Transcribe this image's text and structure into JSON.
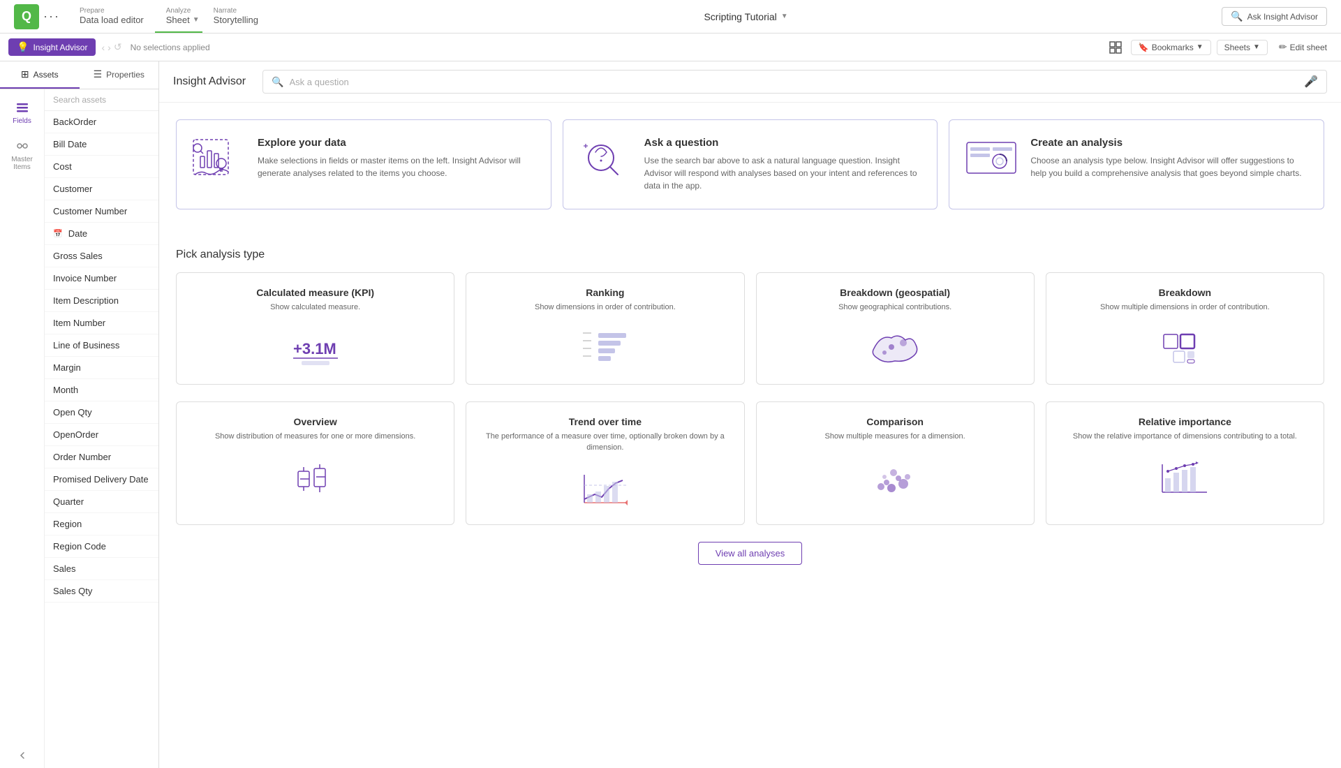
{
  "topbar": {
    "logo_text": "Q",
    "nav_items": [
      {
        "label_top": "Prepare",
        "label_main": "Data load editor",
        "active": false
      },
      {
        "label_top": "Analyze",
        "label_main": "Sheet",
        "active": true
      },
      {
        "label_top": "Narrate",
        "label_main": "Storytelling",
        "active": false
      }
    ],
    "app_title": "Scripting Tutorial",
    "search_btn_label": "Ask Insight Advisor",
    "bookmarks_label": "Bookmarks",
    "sheets_label": "Sheets",
    "edit_sheet_label": "Edit sheet"
  },
  "second_bar": {
    "insight_tab_label": "Insight Advisor",
    "no_selection_label": "No selections applied"
  },
  "sidebar": {
    "tabs": [
      {
        "label": "Assets",
        "active": true
      },
      {
        "label": "Properties",
        "active": false
      }
    ],
    "nav_items": [
      {
        "label": "Fields",
        "active": true,
        "icon": "≡"
      },
      {
        "label": "Master Items",
        "active": false,
        "icon": "⛓"
      }
    ],
    "search_placeholder": "Search assets",
    "fields": [
      {
        "label": "BackOrder",
        "has_icon": false
      },
      {
        "label": "Bill Date",
        "has_icon": false
      },
      {
        "label": "Cost",
        "has_icon": false
      },
      {
        "label": "Customer",
        "has_icon": false
      },
      {
        "label": "Customer Number",
        "has_icon": false
      },
      {
        "label": "Date",
        "has_icon": true,
        "icon": "📅"
      },
      {
        "label": "Gross Sales",
        "has_icon": false
      },
      {
        "label": "Invoice Number",
        "has_icon": false
      },
      {
        "label": "Item Description",
        "has_icon": false
      },
      {
        "label": "Item Number",
        "has_icon": false
      },
      {
        "label": "Line of Business",
        "has_icon": false
      },
      {
        "label": "Margin",
        "has_icon": false
      },
      {
        "label": "Month",
        "has_icon": false
      },
      {
        "label": "Open Qty",
        "has_icon": false
      },
      {
        "label": "OpenOrder",
        "has_icon": false
      },
      {
        "label": "Order Number",
        "has_icon": false
      },
      {
        "label": "Promised Delivery Date",
        "has_icon": false
      },
      {
        "label": "Quarter",
        "has_icon": false
      },
      {
        "label": "Region",
        "has_icon": false
      },
      {
        "label": "Region Code",
        "has_icon": false
      },
      {
        "label": "Sales",
        "has_icon": false
      },
      {
        "label": "Sales Qty",
        "has_icon": false
      }
    ]
  },
  "insight_advisor": {
    "header_title": "Insight Advisor",
    "search_placeholder": "Ask a question",
    "info_cards": [
      {
        "id": "explore",
        "title": "Explore your data",
        "desc": "Make selections in fields or master items on the left. Insight Advisor will generate analyses related to the items you choose."
      },
      {
        "id": "ask",
        "title": "Ask a question",
        "desc": "Use the search bar above to ask a natural language question. Insight Advisor will respond with analyses based on your intent and references to data in the app."
      },
      {
        "id": "create",
        "title": "Create an analysis",
        "desc": "Choose an analysis type below. Insight Advisor will offer suggestions to help you build a comprehensive analysis that goes beyond simple charts."
      }
    ],
    "analysis_section_title": "Pick analysis type",
    "analysis_cards": [
      {
        "id": "kpi",
        "title": "Calculated measure (KPI)",
        "desc": "Show calculated measure.",
        "visual_type": "kpi"
      },
      {
        "id": "ranking",
        "title": "Ranking",
        "desc": "Show dimensions in order of contribution.",
        "visual_type": "ranking"
      },
      {
        "id": "geospatial",
        "title": "Breakdown (geospatial)",
        "desc": "Show geographical contributions.",
        "visual_type": "geo"
      },
      {
        "id": "breakdown",
        "title": "Breakdown",
        "desc": "Show multiple dimensions in order of contribution.",
        "visual_type": "breakdown"
      },
      {
        "id": "overview",
        "title": "Overview",
        "desc": "Show distribution of measures for one or more dimensions.",
        "visual_type": "overview"
      },
      {
        "id": "trend",
        "title": "Trend over time",
        "desc": "The performance of a measure over time, optionally broken down by a dimension.",
        "visual_type": "trend"
      },
      {
        "id": "comparison",
        "title": "Comparison",
        "desc": "Show multiple measures for a dimension.",
        "visual_type": "comparison"
      },
      {
        "id": "relative",
        "title": "Relative importance",
        "desc": "Show the relative importance of dimensions contributing to a total.",
        "visual_type": "relative"
      }
    ],
    "view_all_btn": "View all analyses"
  }
}
